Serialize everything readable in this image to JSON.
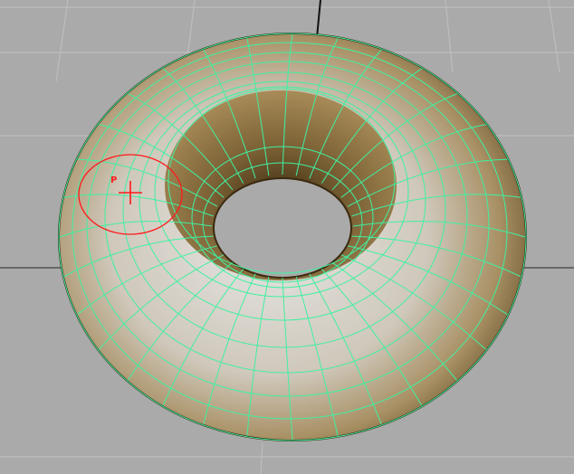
{
  "viewport": {
    "background": "#aaaaaa",
    "grid_line_color": "#bdbdbd",
    "grid_axis_color": "#000000"
  },
  "mesh": {
    "object": "torus",
    "wireframe_color": "#40f0a0",
    "surface_light": "#e6e6e6",
    "surface_mid": "#a89064",
    "surface_dark": "#5c4420",
    "hole_color": "#aaaaaa"
  },
  "brush_cursor": {
    "label": "P",
    "color": "#ff1a1a",
    "icon": "crosshair-icon"
  }
}
